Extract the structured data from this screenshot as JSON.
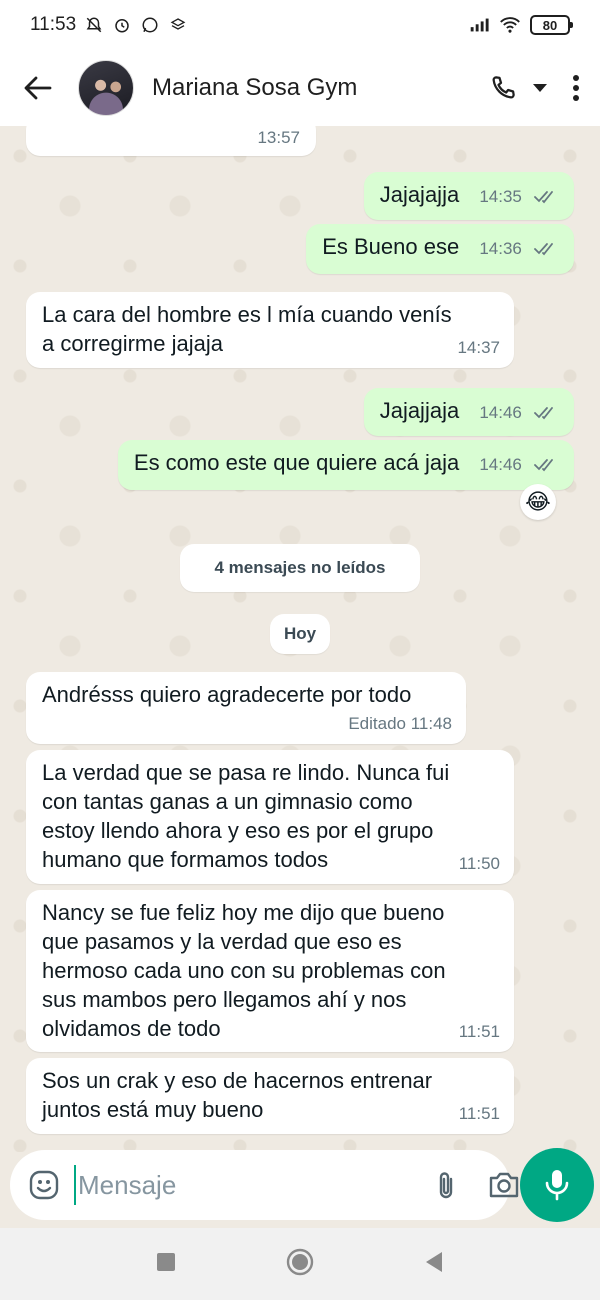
{
  "status_bar": {
    "time": "11:53",
    "battery": "80"
  },
  "header": {
    "contact_name": "Mariana Sosa Gym"
  },
  "messages": [
    {
      "dir": "in",
      "text": "",
      "time": "13:57"
    },
    {
      "dir": "out",
      "text": "Jajajajja",
      "time": "14:35",
      "read": true
    },
    {
      "dir": "out",
      "text": "Es Bueno ese",
      "time": "14:36",
      "read": true
    },
    {
      "dir": "in",
      "text": "La cara del hombre es l mía cuando venís\na corregirme jajaja",
      "time": "14:37"
    },
    {
      "dir": "out",
      "text": "Jajajjaja",
      "time": "14:46",
      "read": true
    },
    {
      "dir": "out",
      "text": "Es como este que quiere acá jaja",
      "time": "14:46",
      "read": true,
      "reaction": "😂"
    },
    {
      "dir": "in",
      "text": "Andrésss quiero agradecerte por todo",
      "time": "Editado 11:48"
    },
    {
      "dir": "in",
      "text": "La verdad que se pasa re lindo. Nunca fui\ncon tantas ganas a un gimnasio como\nestoy llendo ahora y eso es por el grupo\nhumano que formamos todos",
      "time": "11:50"
    },
    {
      "dir": "in",
      "text": "Nancy se fue feliz hoy me dijo que bueno\nque pasamos y la verdad que eso es\nhermoso cada uno con su problemas con\nsus mambos pero llegamos ahí y nos\nolvidamos de todo",
      "time": "11:51"
    },
    {
      "dir": "in",
      "text": "Sos un crak y eso de hacernos entrenar\njuntos está muy bueno",
      "time": "11:51"
    }
  ],
  "unread_label": "4 mensajes no leídos",
  "date_label": "Hoy",
  "input": {
    "placeholder": "Mensaje"
  },
  "colors": {
    "accent": "#00a884",
    "outgoing_bubble": "#d9fdd3",
    "incoming_bubble": "#ffffff",
    "chat_background": "#efeae2"
  }
}
